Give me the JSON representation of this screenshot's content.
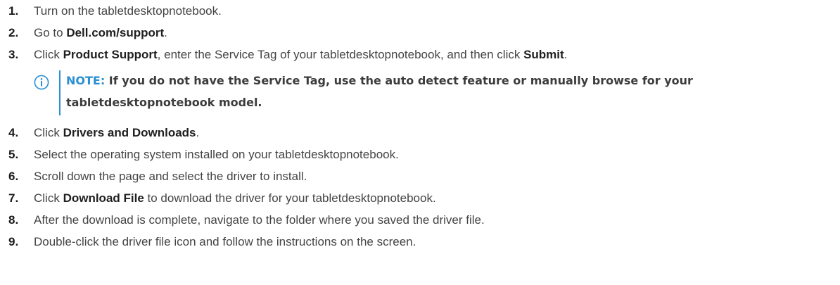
{
  "steps": [
    {
      "num": "1.",
      "parts": [
        "Turn on the tabletdesktopnotebook."
      ]
    },
    {
      "num": "2.",
      "parts": [
        "Go to ",
        "Dell.com/support",
        "."
      ]
    },
    {
      "num": "3.",
      "parts": [
        "Click ",
        "Product Support",
        ", enter the Service Tag of your tabletdesktopnotebook, and then click ",
        "Submit",
        "."
      ]
    },
    {
      "num": "4.",
      "parts": [
        "Click ",
        "Drivers and Downloads",
        "."
      ]
    },
    {
      "num": "5.",
      "parts": [
        "Select the operating system installed on your tabletdesktopnotebook."
      ]
    },
    {
      "num": "6.",
      "parts": [
        "Scroll down the page and select the driver to install."
      ]
    },
    {
      "num": "7.",
      "parts": [
        "Click ",
        "Download File",
        " to download the driver for your tabletdesktopnotebook."
      ]
    },
    {
      "num": "8.",
      "parts": [
        "After the download is complete, navigate to the folder where you saved the driver file."
      ]
    },
    {
      "num": "9.",
      "parts": [
        "Double-click the driver file icon and follow the instructions on the screen."
      ]
    }
  ],
  "note": {
    "label": "NOTE:",
    "text": " If you do not have the Service Tag, use the auto detect feature or manually browse for your tabletdesktopnotebook model."
  },
  "colors": {
    "accent": "#2a8fd3",
    "text": "#444444"
  },
  "icons": {
    "note": "info-circle-icon"
  }
}
